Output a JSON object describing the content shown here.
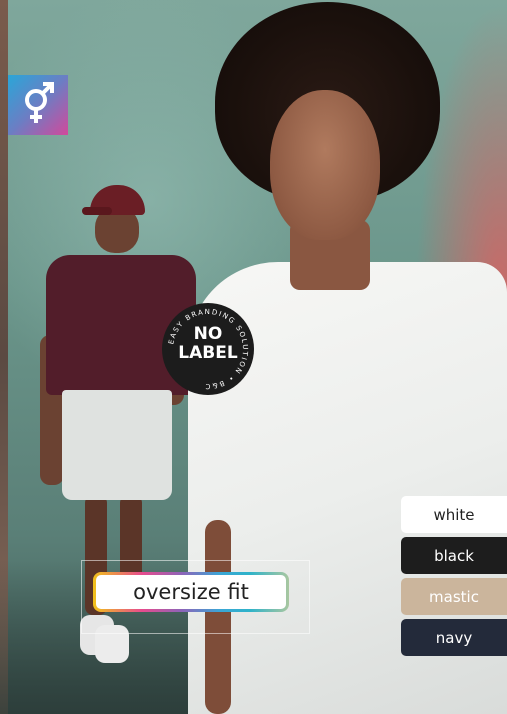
{
  "badge": {
    "icon": "male-female-symbol-icon"
  },
  "stamp": {
    "main_line1": "NO",
    "main_line2": "LABEL",
    "ring_text": "EASY BRANDING SOLUTION • B&C"
  },
  "fit_label": "oversize fit",
  "colors": [
    {
      "label": "white",
      "background": "#ffffff",
      "text": "#222222"
    },
    {
      "label": "black",
      "background": "#1d1d1d",
      "text": "#ffffff"
    },
    {
      "label": "mastic",
      "background": "#cbb59c",
      "text": "#ffffff"
    },
    {
      "label": "navy",
      "background": "#232a3a",
      "text": "#ffffff"
    }
  ]
}
